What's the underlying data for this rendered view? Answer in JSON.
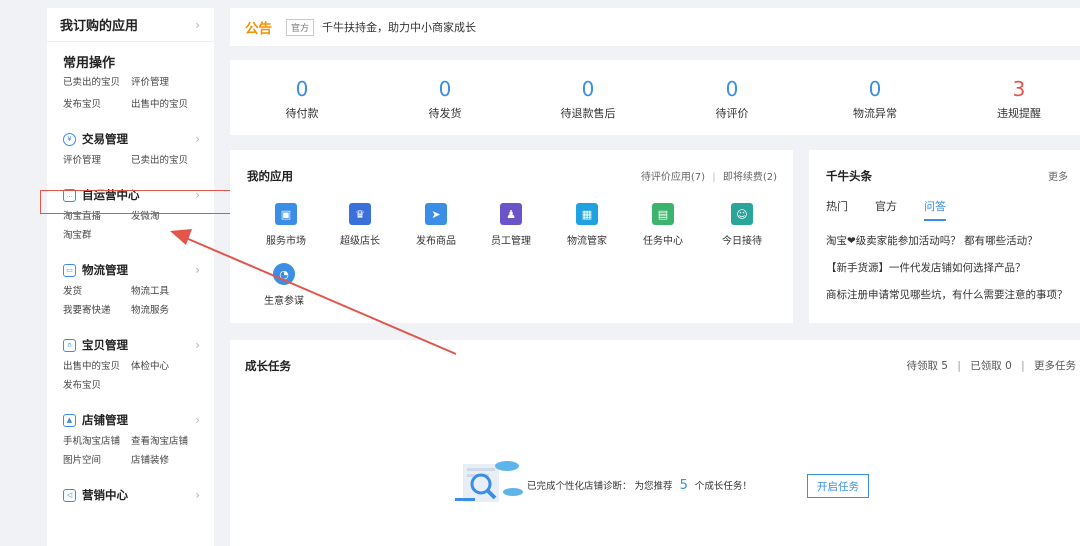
{
  "sidebar": {
    "header": "我订购的应用",
    "common": {
      "title": "常用操作",
      "links": [
        "已卖出的宝贝",
        "评价管理",
        "发布宝贝",
        "出售中的宝贝"
      ]
    },
    "sections": [
      {
        "title": "交易管理",
        "icon": "yen-circle-icon",
        "links": [
          "评价管理",
          "已卖出的宝贝"
        ]
      },
      {
        "title": "自运营中心",
        "icon": "chat-bubble-icon",
        "links": [
          "淘宝直播",
          "发微淘",
          "淘宝群"
        ]
      },
      {
        "title": "物流管理",
        "icon": "truck-icon",
        "links": [
          "发货",
          "物流工具",
          "我要寄快递",
          "物流服务"
        ]
      },
      {
        "title": "宝贝管理",
        "icon": "bag-icon",
        "links": [
          "出售中的宝贝",
          "体检中心",
          "发布宝贝"
        ]
      },
      {
        "title": "店铺管理",
        "icon": "image-icon",
        "links": [
          "手机淘宝店铺",
          "查看淘宝店铺",
          "图片空间",
          "店铺装修"
        ]
      },
      {
        "title": "营销中心",
        "icon": "megaphone-icon",
        "links": []
      }
    ]
  },
  "notice": {
    "label": "公告",
    "source": "官方",
    "text": "千牛扶持金，助力中小商家成长"
  },
  "stats": [
    {
      "value": "0",
      "label": "待付款",
      "color": "#3a8ee6"
    },
    {
      "value": "0",
      "label": "待发货",
      "color": "#3a8ee6"
    },
    {
      "value": "0",
      "label": "待退款售后",
      "color": "#3a8ee6"
    },
    {
      "value": "0",
      "label": "待评价",
      "color": "#3a8ee6"
    },
    {
      "value": "0",
      "label": "物流异常",
      "color": "#3a8ee6"
    },
    {
      "value": "3",
      "label": "违规提醒",
      "color": "#e2554b"
    }
  ],
  "apps": {
    "title": "我的应用",
    "pending_review": "待评价应用(7)",
    "separator": "|",
    "renewal": "即将续费(2)",
    "items": [
      {
        "label": "服务市场",
        "icon": "bag-icon",
        "color": "#3a8ee6"
      },
      {
        "label": "超级店长",
        "icon": "crown-icon",
        "color": "#3b6fd9"
      },
      {
        "label": "发布商品",
        "icon": "paper-plane-icon",
        "color": "#3a8ee6"
      },
      {
        "label": "员工管理",
        "icon": "user-icon",
        "color": "#6a54c8"
      },
      {
        "label": "物流管家",
        "icon": "grid-icon",
        "color": "#1fa3e0"
      },
      {
        "label": "任务中心",
        "icon": "calendar-icon",
        "color": "#3cb46e"
      },
      {
        "label": "今日接待",
        "icon": "person-icon",
        "color": "#2aa59a"
      },
      {
        "label": "生意参谋",
        "icon": "compass-icon",
        "color": "#3a8ee6"
      }
    ]
  },
  "news": {
    "title": "千牛头条",
    "more": "更多",
    "tabs": [
      "热门",
      "官方",
      "问答"
    ],
    "active_tab": "问答",
    "items": [
      "淘宝❤级卖家能参加活动吗？ 都有哪些活动？",
      "【新手货源】一件代发店铺如何选择产品？",
      "商标注册申请常见哪些坑，有什么需要注意的事项？"
    ]
  },
  "growth": {
    "title": "成长任务",
    "pending": "待领取 5",
    "claimed": "已领取 0",
    "more": "更多任务",
    "separator": "|",
    "message_prefix": "已完成个性化店铺诊断： 为您推荐",
    "count": "5",
    "message_suffix": "个成长任务！",
    "button": "开启任务"
  }
}
